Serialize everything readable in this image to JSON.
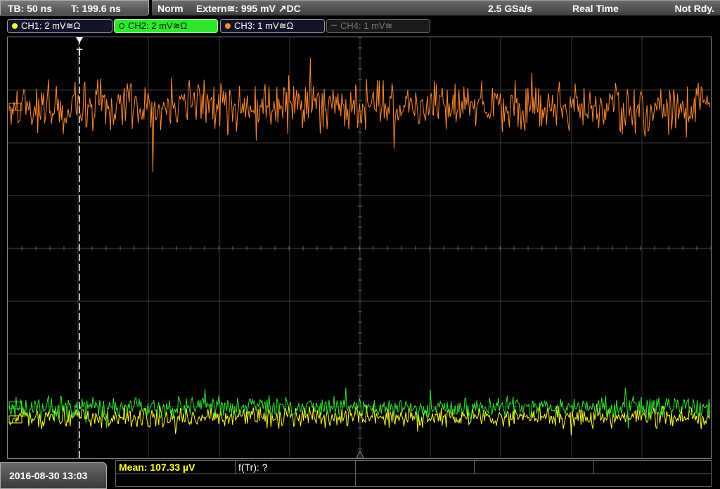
{
  "timebase": {
    "tb": "TB: 50 ns",
    "t": "T: 199.6 ns"
  },
  "status_bar": {
    "mode": "Norm",
    "trigger": "Extern≅: 995 mV ↗DC",
    "sample_rate": "2.5 GSa/s",
    "acquisition": "Real Time",
    "state": "Not Rdy."
  },
  "channels": [
    {
      "label": "CH1: 2 mV≅Ω",
      "color": "#ffff33",
      "active": false
    },
    {
      "label": "CH2: 2 mV≅Ω",
      "color": "#2ee62e",
      "active": true
    },
    {
      "label": "CH3: 1 mV≅Ω",
      "color": "#ff8a33",
      "active": false
    },
    {
      "label": "CH4: 1 mV≅",
      "color": "#666666",
      "active": false
    }
  ],
  "trigger_marker": "T",
  "measurements": {
    "mean": "Mean: 107.33 µV",
    "ftr": "f(Tr): ?"
  },
  "datetime": "2016-08-30 13:03",
  "colors": {
    "ch1": "#ffff33",
    "ch2": "#2ee62e",
    "ch3": "#ff8a33",
    "grid": "#3a3a3a",
    "trigger_line": "#ffffff"
  }
}
